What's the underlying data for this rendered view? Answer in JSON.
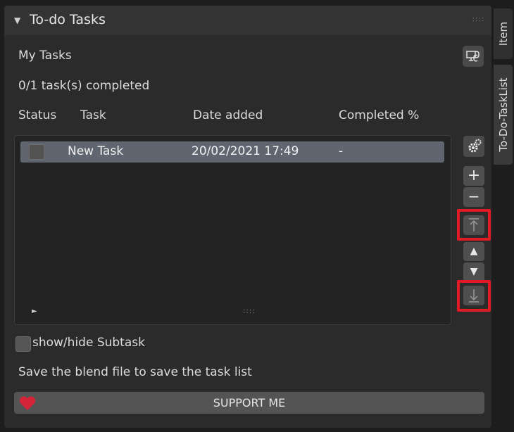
{
  "panel": {
    "title": "To-do Tasks",
    "collapse_icon": "▼",
    "drag_grip": "::::"
  },
  "tasks": {
    "heading": "My Tasks",
    "progress": "0/1 task(s) completed",
    "columns": [
      "Status",
      "Task",
      "Date added",
      "Completed %"
    ],
    "rows": [
      {
        "completed": false,
        "task": "New Task",
        "date": "20/02/2021 17:49",
        "percent": "-"
      }
    ],
    "expand_icon": "►",
    "list_grip": "::::"
  },
  "side_buttons": {
    "add": "+",
    "remove": "−",
    "up": "▲",
    "down": "▼"
  },
  "subtask": {
    "label": "show/hide Subtask",
    "checked": false
  },
  "footer": {
    "note": "Save the blend file to save the task list",
    "support_label": "SUPPORT ME"
  },
  "tabs": {
    "item": "Item",
    "todo": "To-Do-TaskList"
  },
  "colors": {
    "highlight": "#e01b24",
    "heart": "#d4243a",
    "selected_row": "#606670"
  },
  "icons": [
    "link-icon",
    "gear-icon",
    "move-top-icon",
    "move-bottom-icon",
    "heart-icon"
  ]
}
